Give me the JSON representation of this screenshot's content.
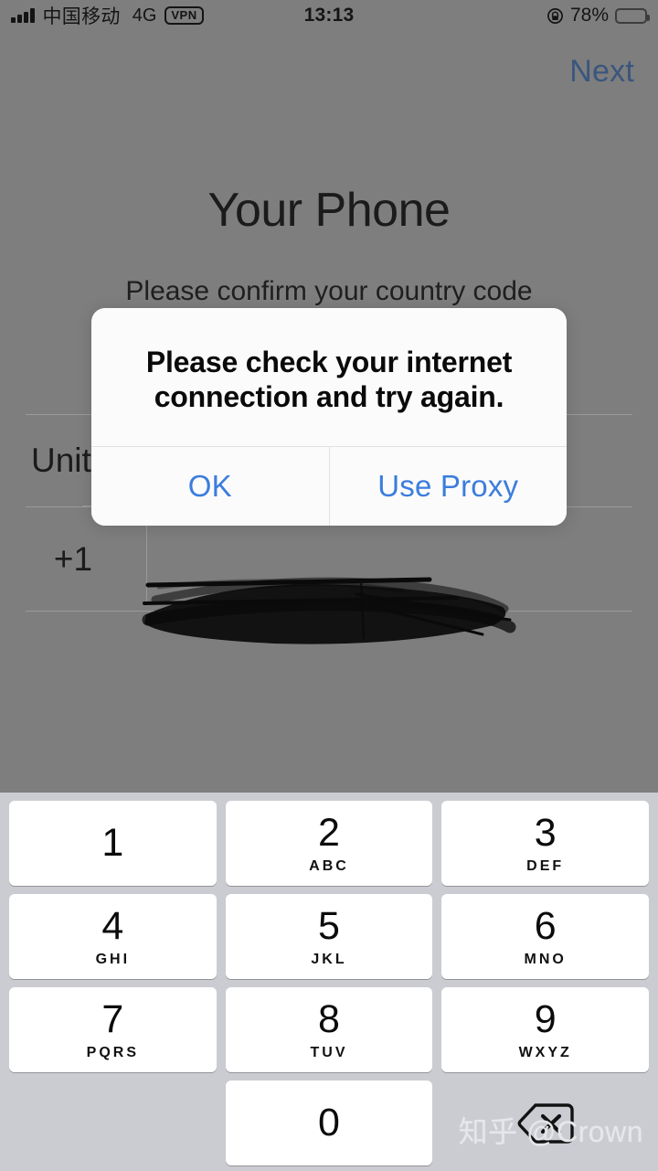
{
  "status_bar": {
    "carrier": "中国移动",
    "network": "4G",
    "vpn": "VPN",
    "time": "13:13",
    "battery_percent": "78%",
    "battery_level": 78,
    "signal_bars": 4,
    "icons": [
      "signal-bars-icon",
      "vpn-badge-icon",
      "rotation-lock-icon",
      "battery-icon"
    ]
  },
  "page": {
    "next_label": "Next",
    "title": "Your Phone",
    "subtitle": "Please confirm your country code",
    "country_name": "United States",
    "country_code": "+1",
    "phone_number": "",
    "phone_redacted": true
  },
  "alert": {
    "message": "Please check your internet connection and try again.",
    "buttons": [
      {
        "label": "OK",
        "name": "ok-button"
      },
      {
        "label": "Use Proxy",
        "name": "use-proxy-button"
      }
    ]
  },
  "keyboard": {
    "type": "numeric-phone-pad",
    "keys": [
      {
        "digit": "1",
        "letters": ""
      },
      {
        "digit": "2",
        "letters": "ABC"
      },
      {
        "digit": "3",
        "letters": "DEF"
      },
      {
        "digit": "4",
        "letters": "GHI"
      },
      {
        "digit": "5",
        "letters": "JKL"
      },
      {
        "digit": "6",
        "letters": "MNO"
      },
      {
        "digit": "7",
        "letters": "PQRS"
      },
      {
        "digit": "8",
        "letters": "TUV"
      },
      {
        "digit": "9",
        "letters": "WXYZ"
      },
      {
        "digit": "0",
        "letters": ""
      }
    ],
    "delete_icon": "backspace-delete-icon"
  },
  "watermark": "知乎 @Crown",
  "colors": {
    "dim_background": "#7e7e7e",
    "accent_blue": "#3b7ddd",
    "next_blue_dimmed": "#3a567e",
    "keyboard_background": "#cbccd2",
    "key_white": "#ffffff",
    "alert_white": "#fbfbfb",
    "separator": "#9a9a9a"
  }
}
